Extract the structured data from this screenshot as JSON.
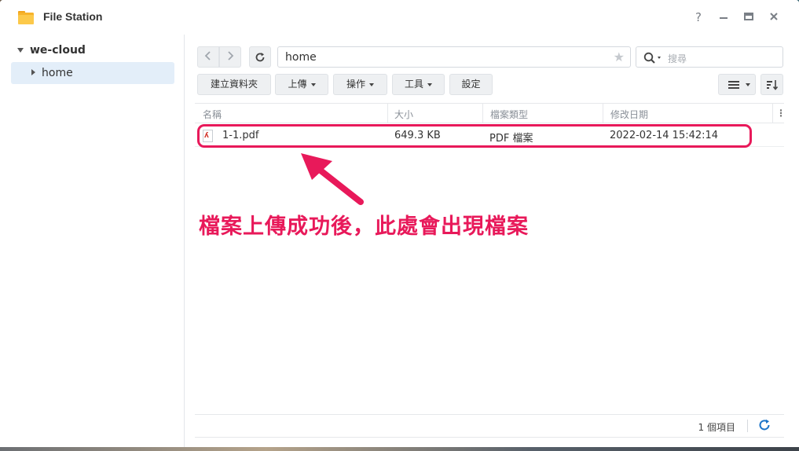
{
  "window": {
    "title": "File Station",
    "controls": [
      "help-icon",
      "minimize-icon",
      "maximize-icon",
      "close-icon"
    ]
  },
  "sidebar": {
    "root_label": "we-cloud",
    "items": [
      {
        "label": "home",
        "selected": true
      }
    ]
  },
  "toolbar": {
    "path": "home",
    "search_placeholder": "搜尋",
    "buttons": {
      "create_folder": "建立資料夾",
      "upload": "上傳",
      "action": "操作",
      "tools": "工具",
      "settings": "設定"
    }
  },
  "table": {
    "headers": {
      "name": "名稱",
      "size": "大小",
      "type": "檔案類型",
      "modified": "修改日期"
    },
    "rows": [
      {
        "name": "1-1.pdf",
        "size": "649.3 KB",
        "type": "PDF 檔案",
        "modified": "2022-02-14 15:42:14"
      }
    ]
  },
  "annotation": {
    "text": "檔案上傳成功後，此處會出現檔案",
    "color": "#e8195a"
  },
  "footer": {
    "count": "1 個項目"
  },
  "colors": {
    "accent": "#1a73c8",
    "selection": "#e3eef9",
    "highlight": "#e8195a"
  }
}
